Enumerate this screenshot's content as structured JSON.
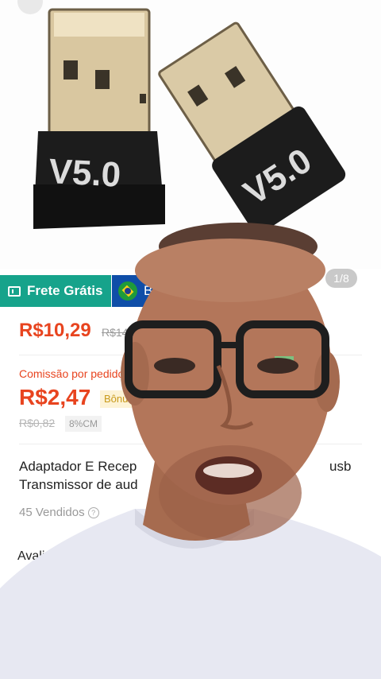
{
  "product": {
    "page_counter": "1/8",
    "image_labels": [
      "V5.0",
      "V5.0"
    ]
  },
  "badges": {
    "shipping": "Frete Grátis",
    "origin_text": "B"
  },
  "price": {
    "current": "R$10,29",
    "original": "R$14"
  },
  "commission": {
    "label": "Comissão por pedido",
    "value": "R$2,47",
    "bonus": "Bônu",
    "old": "R$0,82",
    "rate": "8%CM"
  },
  "listing": {
    "title_line1": "Adaptador E Recep",
    "title_line1_end": "usb",
    "title_line2": "Transmissor de aud",
    "sold": "45 Vendidos",
    "reviews": "Avalia"
  },
  "colors": {
    "accent": "#e8441f",
    "shipping_badge": "#16a38b",
    "origin_badge": "#0f4ea8"
  }
}
